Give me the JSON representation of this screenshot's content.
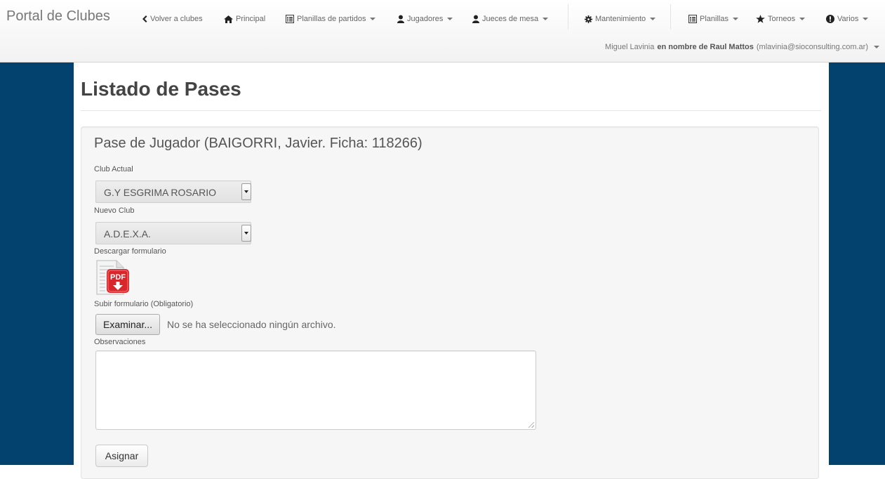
{
  "navbar": {
    "brand": "Portal de Clubes",
    "items": [
      {
        "label": "Volver a clubes",
        "icon": "chevron-left-icon",
        "dropdown": false
      },
      {
        "label": "Principal",
        "icon": "home-icon",
        "dropdown": false
      },
      {
        "label": "Planillas de partidos",
        "icon": "list-alt-icon",
        "dropdown": true
      },
      {
        "label": "Jugadores",
        "icon": "user-icon",
        "dropdown": true
      },
      {
        "label": "Jueces de mesa",
        "icon": "user-icon",
        "dropdown": true
      },
      {
        "label": "Mantenimiento",
        "icon": "cog-icon",
        "dropdown": true
      },
      {
        "label": "Planillas",
        "icon": "list-alt-icon",
        "dropdown": true
      },
      {
        "label": "Torneos",
        "icon": "star-icon",
        "dropdown": true
      },
      {
        "label": "Varios",
        "icon": "exclamation-sign-icon",
        "dropdown": true
      }
    ]
  },
  "user": {
    "name": "Miguel Lavinia",
    "on_behalf": "en nombre de Raul Mattos",
    "email": "(mlavinia@sioconsulting.com.ar)"
  },
  "page": {
    "title": "Listado de Pases",
    "form": {
      "legend": "Pase de Jugador (BAIGORRI, Javier. Ficha: 118266)",
      "club_actual_label": "Club Actual",
      "club_actual_value": "G.Y ESGRIMA ROSARIO",
      "nuevo_club_label": "Nuevo Club",
      "nuevo_club_value": "A.D.E.X.A.",
      "descargar_label": "Descargar formulario",
      "subir_label": "Subir formulario (Obligatorio)",
      "file_button": "Examinar...",
      "file_status": "No se ha seleccionado ningún archivo.",
      "observaciones_label": "Observaciones",
      "observaciones_value": "",
      "submit_label": "Asignar"
    }
  },
  "colors": {
    "side_band": "#03426e",
    "navbar_text": "#666666",
    "pdf_red": "#d9262b"
  }
}
